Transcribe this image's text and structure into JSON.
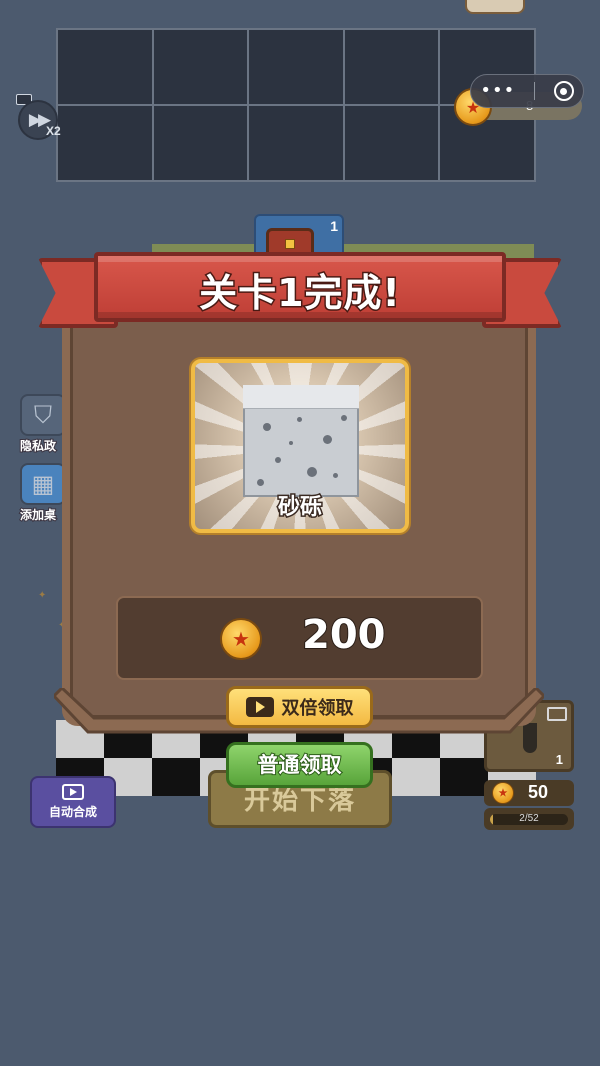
{
  "hud": {
    "speed_label": "X2",
    "coins": "8",
    "capsule_menu": "•••"
  },
  "board": {
    "chest_count": "1"
  },
  "side_buttons": [
    {
      "label": "隐私政"
    },
    {
      "label": "添加桌"
    }
  ],
  "bottom": {
    "auto_merge": "自动合成",
    "start_drop": "开始下落",
    "slot_count": "1",
    "price": "50",
    "progress_text": "2/52",
    "progress_fraction": 0.04
  },
  "dialog": {
    "title": "关卡1完成!",
    "reward_name": "砂砾",
    "amount": "200",
    "double_claim": "双倍领取",
    "normal_claim": "普通领取"
  },
  "colors": {
    "background": "#4c5a6e",
    "banner": "#c94a3e",
    "panel": "#7b5e4c",
    "gold_border": "#f0bb45",
    "green_button": "#58a43a"
  }
}
